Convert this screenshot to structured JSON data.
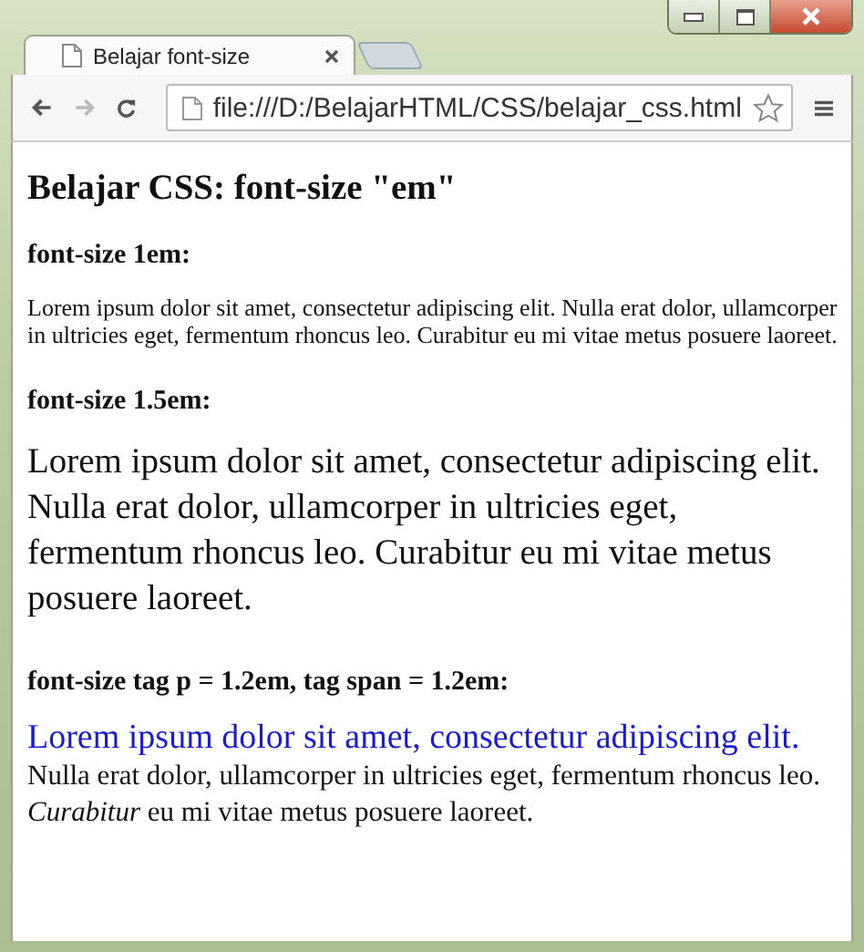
{
  "tabs": [
    {
      "kind": "page",
      "title": "Belajar font-size",
      "selected": true
    },
    {
      "kind": "new",
      "selected": false
    }
  ],
  "toolbar": {
    "address": "file:///D:/BelajarHTML/CSS/belajar_css.html"
  },
  "page": {
    "title": "Belajar CSS: font-size \"em\"",
    "sections": [
      {
        "heading": "font-size 1em:",
        "kind": "small",
        "segments": [
          {
            "kind": "plain",
            "text": "Lorem ipsum dolor sit amet, consectetur adipiscing elit. Nulla erat dolor, ullamcorper in ultricies eget, fermentum rhoncus leo. Curabitur eu mi vitae metus posuere laoreet."
          }
        ]
      },
      {
        "heading": "font-size 1.5em:",
        "kind": "large",
        "segments": [
          {
            "kind": "plain",
            "text": "Lorem ipsum dolor sit amet, consectetur adipiscing elit. Nulla erat dolor, ullamcorper in ultricies eget, fermentum rhoncus leo. Curabitur eu mi vitae metus posuere laoreet."
          }
        ]
      },
      {
        "heading": "font-size tag p = 1.2em, tag span = 1.2em:",
        "kind": "medium",
        "segments": [
          {
            "kind": "span",
            "text": "Lorem ipsum dolor sit amet, consectetur adipiscing elit."
          },
          {
            "kind": "plain",
            "text": " Nulla erat dolor, ullamcorper in ultricies eget, fermentum rhoncus leo. *Curabitur* eu mi vitae metus posuere laoreet."
          }
        ]
      }
    ]
  }
}
